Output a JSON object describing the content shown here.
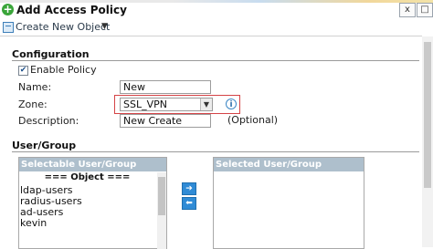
{
  "window": {
    "title": "Add Access Policy",
    "close_label": "x",
    "maximize_label": "□"
  },
  "toolbar": {
    "create_label": "Create New Object",
    "caret": "▼"
  },
  "configuration": {
    "section_title": "Configuration",
    "enable_label": "Enable Policy",
    "enable_checked": true,
    "name_label": "Name:",
    "name_value": "New",
    "zone_label": "Zone:",
    "zone_value": "SSL_VPN",
    "description_label": "Description:",
    "description_value": "New Create",
    "description_hint": "(Optional)"
  },
  "user_group": {
    "section_title": "User/Group",
    "selectable_header": "Selectable User/Group Objects",
    "selected_header": "Selected User/Group Objects",
    "group_heading": "=== Object ===",
    "items": [
      "ldap-users",
      "radius-users",
      "ad-users",
      "kevin"
    ],
    "add_arrow": "➔",
    "remove_arrow": "⬅"
  },
  "icons": {
    "title_icon": "add-circle-icon",
    "toolbar_icon": "create-object-icon",
    "info_icon": "info-icon",
    "checkbox_mark": "✔"
  },
  "colors": {
    "accent": "#2f8bd6",
    "panel_header": "#aebfcc",
    "highlight_border": "#d44346",
    "title_icon": "#3aa53a"
  }
}
